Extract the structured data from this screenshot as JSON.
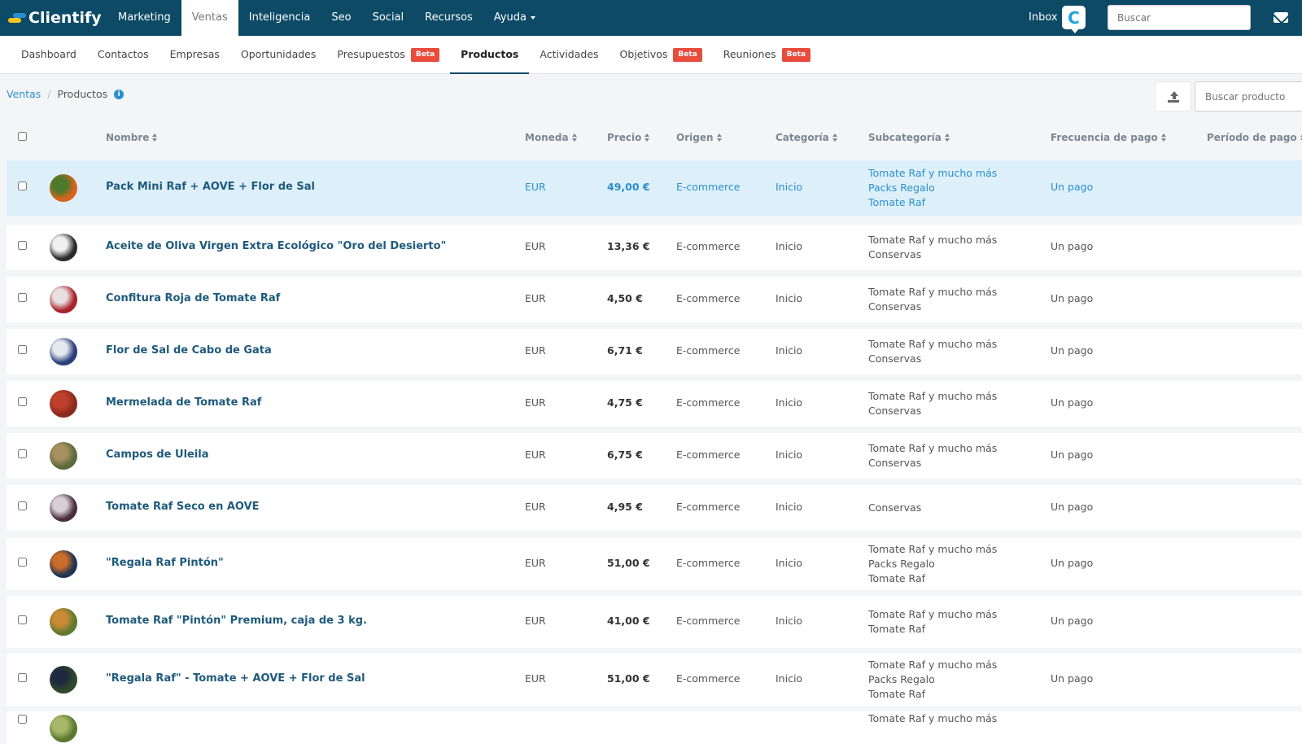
{
  "app": {
    "logo_text": "Clientify",
    "brand_color": "#0c4a66",
    "accent_color": "#2a8fd0"
  },
  "topnav": [
    {
      "label": "Marketing"
    },
    {
      "label": "Ventas",
      "active": true
    },
    {
      "label": "Inteligencia"
    },
    {
      "label": "Seo"
    },
    {
      "label": "Social"
    },
    {
      "label": "Recursos"
    },
    {
      "label": "Ayuda",
      "dropdown": true
    }
  ],
  "header": {
    "inbox_label": "Inbox",
    "inbox_badge": "C",
    "search_placeholder": "Buscar",
    "mail_icon": "envelope-icon"
  },
  "subnav": [
    {
      "label": "Dashboard"
    },
    {
      "label": "Contactos"
    },
    {
      "label": "Empresas"
    },
    {
      "label": "Oportunidades"
    },
    {
      "label": "Presupuestos",
      "badge": "Beta"
    },
    {
      "label": "Productos",
      "active": true
    },
    {
      "label": "Actividades"
    },
    {
      "label": "Objetivos",
      "badge": "Beta"
    },
    {
      "label": "Reuniones",
      "badge": "Beta"
    }
  ],
  "breadcrumb": {
    "parent": "Ventas",
    "separator": "/",
    "current": "Productos",
    "info_icon": "i"
  },
  "toolbar": {
    "export_icon": "upload-icon",
    "search_placeholder": "Buscar producto"
  },
  "table": {
    "columns": [
      "Nombre",
      "Moneda",
      "Precio",
      "Origen",
      "Categoría",
      "Subcategoría",
      "Frecuencia de pago",
      "Período de pago"
    ],
    "rows": [
      {
        "name": "Pack Mini Raf + AOVE + Flor de Sal",
        "currency": "EUR",
        "price": "49,00 €",
        "origin": "E-commerce",
        "category": "Inicio",
        "subcategories": [
          "Tomate Raf y mucho más",
          "Packs Regalo",
          "Tomate Raf"
        ],
        "frequency": "Un pago",
        "selected": true,
        "thumb": [
          "#d9631e",
          "#4a7a2a"
        ]
      },
      {
        "name": "Aceite de Oliva Virgen Extra Ecológico \"Oro del Desierto\"",
        "currency": "EUR",
        "price": "13,36 €",
        "origin": "E-commerce",
        "category": "Inicio",
        "subcategories": [
          "Tomate Raf y mucho más",
          "Conservas"
        ],
        "frequency": "Un pago",
        "thumb": [
          "#2b2b2b",
          "#f0f0f0"
        ]
      },
      {
        "name": "Confitura Roja de Tomate Raf",
        "currency": "EUR",
        "price": "4,50 €",
        "origin": "E-commerce",
        "category": "Inicio",
        "subcategories": [
          "Tomate Raf y mucho más",
          "Conservas"
        ],
        "frequency": "Un pago",
        "thumb": [
          "#a8232b",
          "#e8e0e0"
        ]
      },
      {
        "name": "Flor de Sal de Cabo de Gata",
        "currency": "EUR",
        "price": "6,71 €",
        "origin": "E-commerce",
        "category": "Inicio",
        "subcategories": [
          "Tomate Raf y mucho más",
          "Conservas"
        ],
        "frequency": "Un pago",
        "thumb": [
          "#2a3f7a",
          "#e6e8f0"
        ]
      },
      {
        "name": "Mermelada de Tomate Raf",
        "currency": "EUR",
        "price": "4,75 €",
        "origin": "E-commerce",
        "category": "Inicio",
        "subcategories": [
          "Tomate Raf y mucho más",
          "Conservas"
        ],
        "frequency": "Un pago",
        "thumb": [
          "#8a2a1e",
          "#c0412b"
        ]
      },
      {
        "name": "Campos de Uleila",
        "currency": "EUR",
        "price": "6,75 €",
        "origin": "E-commerce",
        "category": "Inicio",
        "subcategories": [
          "Tomate Raf y mucho más",
          "Conservas"
        ],
        "frequency": "Un pago",
        "thumb": [
          "#5c6b3a",
          "#a89060"
        ]
      },
      {
        "name": "Tomate Raf Seco en AOVE",
        "currency": "EUR",
        "price": "4,95 €",
        "origin": "E-commerce",
        "category": "Inicio",
        "subcategories": [
          "Conservas"
        ],
        "frequency": "Un pago",
        "thumb": [
          "#4a2e3a",
          "#d7cfd5"
        ]
      },
      {
        "name": "\"Regala Raf Pintón\"",
        "currency": "EUR",
        "price": "51,00 €",
        "origin": "E-commerce",
        "category": "Inicio",
        "subcategories": [
          "Tomate Raf y mucho más",
          "Packs Regalo",
          "Tomate Raf"
        ],
        "frequency": "Un pago",
        "thumb": [
          "#1f3550",
          "#c96d2a"
        ]
      },
      {
        "name": "Tomate Raf \"Pintón\" Premium, caja de 3 kg.",
        "currency": "EUR",
        "price": "41,00 €",
        "origin": "E-commerce",
        "category": "Inicio",
        "subcategories": [
          "Tomate Raf y mucho más",
          "Tomate Raf"
        ],
        "frequency": "Un pago",
        "thumb": [
          "#5f7a2e",
          "#c98a35"
        ]
      },
      {
        "name": "\"Regala Raf\" - Tomate + AOVE + Flor de Sal",
        "currency": "EUR",
        "price": "51,00 €",
        "origin": "E-commerce",
        "category": "Inicio",
        "subcategories": [
          "Tomate Raf y mucho más",
          "Packs Regalo",
          "Tomate Raf"
        ],
        "frequency": "Un pago",
        "thumb": [
          "#2e4a2a",
          "#1f2a3f"
        ]
      },
      {
        "name": "",
        "currency": "",
        "price": "",
        "origin": "",
        "category": "",
        "subcategories": [
          "Tomate Raf y mucho más"
        ],
        "frequency": "",
        "thumb": [
          "#5a7a2e",
          "#a8b86a"
        ]
      }
    ]
  }
}
